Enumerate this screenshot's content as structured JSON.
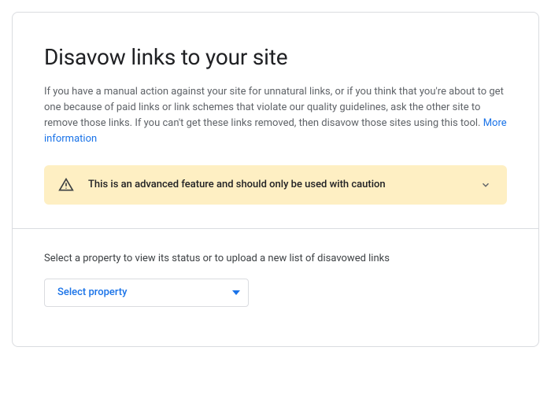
{
  "header": {
    "title": "Disavow links to your site",
    "description": "If you have a manual action against your site for unnatural links, or if you think that you're about to get one because of paid links or link schemes that violate our quality guidelines, ask the other site to remove those links. If you can't get these links removed, then disavow those sites using this tool. ",
    "moreInfoLabel": "More information"
  },
  "warning": {
    "text": "This is an advanced feature and should only be used with caution"
  },
  "propertySection": {
    "label": "Select a property to view its status or to upload a new list of disavowed links",
    "selectPlaceholder": "Select property"
  },
  "colors": {
    "link": "#1a73e8",
    "warningBg": "#feefc3",
    "border": "#dadce0"
  }
}
